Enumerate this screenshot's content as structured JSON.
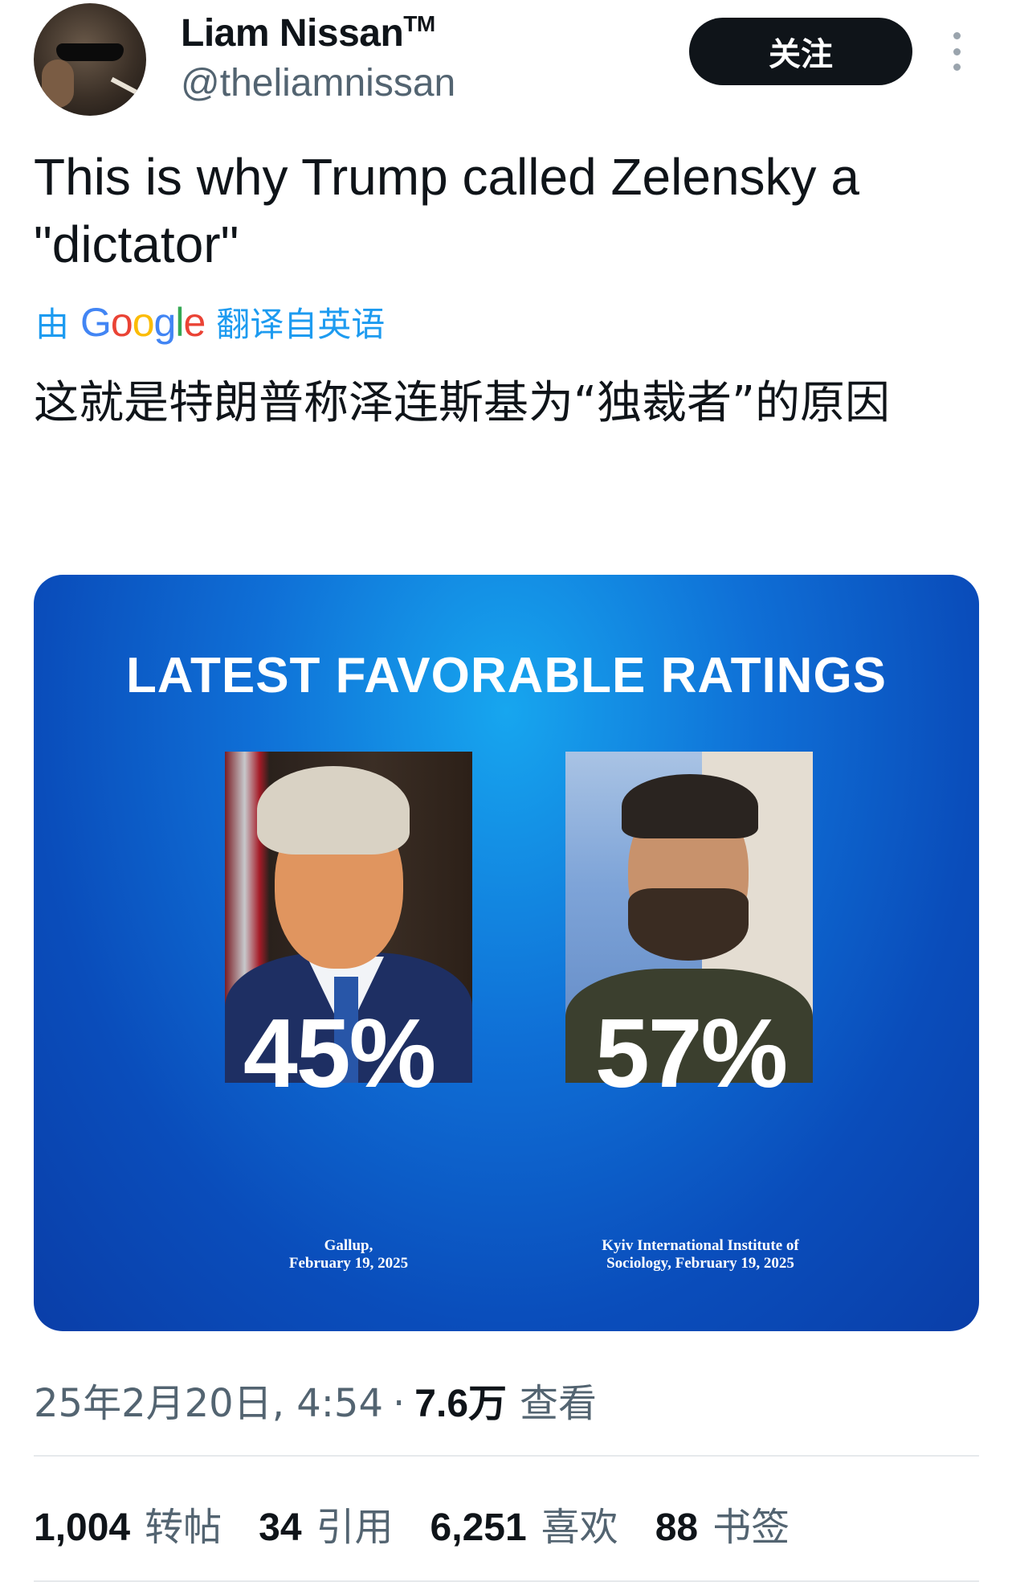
{
  "author": {
    "name": "Liam Nissan",
    "name_mark": "TM",
    "handle": "@theliamnissan"
  },
  "follow_label": "关注",
  "tweet": {
    "text": "This is why Trump called Zelensky a \"dictator\"",
    "translate_prefix": "由",
    "translate_brand": "Google",
    "translate_suffix": "翻译自英语",
    "translated_text": "这就是特朗普称泽连斯基为“独裁者”的原因"
  },
  "image": {
    "title": "LATEST FAVORABLE RATINGS",
    "left": {
      "value": "45%",
      "source_line1": "Gallup,",
      "source_line2": "February 19, 2025"
    },
    "right": {
      "value": "57%",
      "source_line1": "Kyiv International Institute of",
      "source_line2": "Sociology, February 19, 2025"
    }
  },
  "meta": {
    "datetime": "25年2月20日, 4:54",
    "separator": "·",
    "views": "7.6万",
    "views_label": "查看"
  },
  "stats": [
    {
      "count": "1,004",
      "label": "转帖"
    },
    {
      "count": "34",
      "label": "引用"
    },
    {
      "count": "6,251",
      "label": "喜欢"
    },
    {
      "count": "88",
      "label": "书签"
    }
  ],
  "colors": {
    "accent": "#1d9bf0",
    "text": "#0f1419",
    "muted": "#536471",
    "image_bg": "#0a4dbb"
  }
}
